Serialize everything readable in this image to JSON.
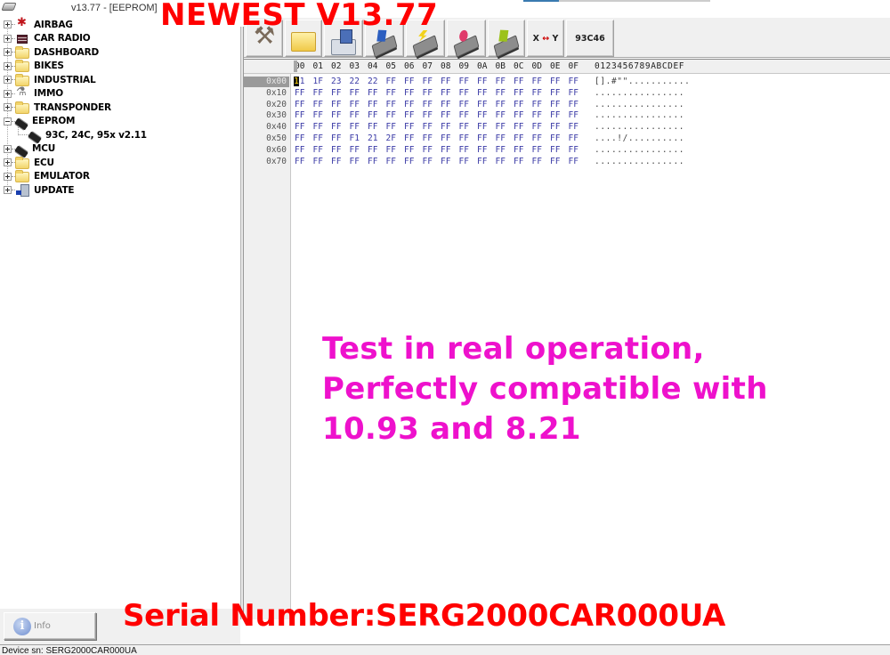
{
  "window": {
    "title": "v13.77 - [EEPROM]"
  },
  "promo": {
    "headline": "NEWEST V13.77",
    "body_lines": [
      "Test in real operation,",
      "Perfectly compatible with",
      "10.93 and 8.21"
    ],
    "serial_banner": "Serial Number:SERG2000CAR000UA",
    "colors": {
      "headline": "#ff0000",
      "body": "#ee11cc"
    }
  },
  "tree": {
    "items": [
      {
        "label": "AIRBAG",
        "icon": "airbag-icon",
        "expanded": false
      },
      {
        "label": "CAR RADIO",
        "icon": "car-radio-icon",
        "expanded": false
      },
      {
        "label": "DASHBOARD",
        "icon": "folder-icon",
        "expanded": false
      },
      {
        "label": "BIKES",
        "icon": "folder-icon",
        "expanded": false
      },
      {
        "label": "INDUSTRIAL",
        "icon": "folder-icon",
        "expanded": false
      },
      {
        "label": "IMMO",
        "icon": "immo-icon",
        "expanded": false
      },
      {
        "label": "TRANSPONDER",
        "icon": "folder-icon",
        "expanded": false
      },
      {
        "label": "EEPROM",
        "icon": "chip-icon",
        "expanded": true,
        "children": [
          {
            "label": "93C, 24C, 95x v2.11",
            "icon": "chip-icon"
          }
        ]
      },
      {
        "label": "MCU",
        "icon": "chip-icon",
        "expanded": false
      },
      {
        "label": "ECU",
        "icon": "folder-icon",
        "expanded": false
      },
      {
        "label": "EMULATOR",
        "icon": "folder-icon",
        "expanded": false
      },
      {
        "label": "UPDATE",
        "icon": "update-icon",
        "expanded": false
      }
    ]
  },
  "toolbar": {
    "buttons": [
      {
        "name": "settings",
        "icon": "tools-icon"
      },
      {
        "name": "open",
        "icon": "folder-open-icon"
      },
      {
        "name": "save",
        "icon": "save-disk-icon"
      },
      {
        "name": "read",
        "icon": "chip-read-icon"
      },
      {
        "name": "write",
        "icon": "chip-write-icon"
      },
      {
        "name": "verify",
        "icon": "chip-verify-icon"
      },
      {
        "name": "erase",
        "icon": "chip-erase-icon"
      }
    ],
    "swap_label_x": "X",
    "swap_arrow": "↔",
    "swap_label_y": "Y",
    "chip_type": "93C46"
  },
  "hex": {
    "column_headers": [
      "00",
      "01",
      "02",
      "03",
      "04",
      "05",
      "06",
      "07",
      "08",
      "09",
      "0A",
      "0B",
      "0C",
      "0D",
      "0E",
      "0F"
    ],
    "ascii_header": "0123456789ABCDEF",
    "selected_address": "0x00",
    "cursor_char": "1",
    "rows": [
      {
        "addr": "0x00",
        "bytes": [
          "11",
          "1F",
          "23",
          "22",
          "22",
          "FF",
          "FF",
          "FF",
          "FF",
          "FF",
          "FF",
          "FF",
          "FF",
          "FF",
          "FF",
          "FF"
        ],
        "ascii": "[].#\"\"..........."
      },
      {
        "addr": "0x10",
        "bytes": [
          "FF",
          "FF",
          "FF",
          "FF",
          "FF",
          "FF",
          "FF",
          "FF",
          "FF",
          "FF",
          "FF",
          "FF",
          "FF",
          "FF",
          "FF",
          "FF"
        ],
        "ascii": "................"
      },
      {
        "addr": "0x20",
        "bytes": [
          "FF",
          "FF",
          "FF",
          "FF",
          "FF",
          "FF",
          "FF",
          "FF",
          "FF",
          "FF",
          "FF",
          "FF",
          "FF",
          "FF",
          "FF",
          "FF"
        ],
        "ascii": "................"
      },
      {
        "addr": "0x30",
        "bytes": [
          "FF",
          "FF",
          "FF",
          "FF",
          "FF",
          "FF",
          "FF",
          "FF",
          "FF",
          "FF",
          "FF",
          "FF",
          "FF",
          "FF",
          "FF",
          "FF"
        ],
        "ascii": "................"
      },
      {
        "addr": "0x40",
        "bytes": [
          "FF",
          "FF",
          "FF",
          "FF",
          "FF",
          "FF",
          "FF",
          "FF",
          "FF",
          "FF",
          "FF",
          "FF",
          "FF",
          "FF",
          "FF",
          "FF"
        ],
        "ascii": "................"
      },
      {
        "addr": "0x50",
        "bytes": [
          "FF",
          "FF",
          "FF",
          "F1",
          "21",
          "2F",
          "FF",
          "FF",
          "FF",
          "FF",
          "FF",
          "FF",
          "FF",
          "FF",
          "FF",
          "FF"
        ],
        "ascii": "....!/.........."
      },
      {
        "addr": "0x60",
        "bytes": [
          "FF",
          "FF",
          "FF",
          "FF",
          "FF",
          "FF",
          "FF",
          "FF",
          "FF",
          "FF",
          "FF",
          "FF",
          "FF",
          "FF",
          "FF",
          "FF"
        ],
        "ascii": "................"
      },
      {
        "addr": "0x70",
        "bytes": [
          "FF",
          "FF",
          "FF",
          "FF",
          "FF",
          "FF",
          "FF",
          "FF",
          "FF",
          "FF",
          "FF",
          "FF",
          "FF",
          "FF",
          "FF",
          "FF"
        ],
        "ascii": "................"
      }
    ]
  },
  "info_button": {
    "icon_glyph": "i",
    "label": "Info"
  },
  "status_bar": {
    "text": "Device sn: SERG2000CAR000UA"
  }
}
